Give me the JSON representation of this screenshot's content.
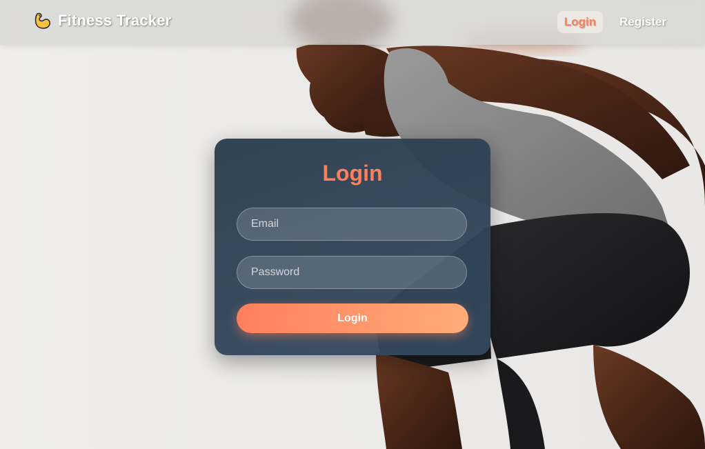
{
  "navbar": {
    "brand_text": "Fitness Tracker",
    "brand_icon": "flexed-biceps-icon",
    "links": [
      {
        "label": "Login",
        "active": true
      },
      {
        "label": "Register",
        "active": false
      }
    ]
  },
  "login_form": {
    "title": "Login",
    "email_placeholder": "Email",
    "email_value": "",
    "password_placeholder": "Password",
    "password_value": "",
    "submit_label": "Login"
  },
  "colors": {
    "accent": "#ff7f5c",
    "accent_gradient_end": "#ffac78",
    "card_bg": "#2c3e50",
    "nav_text": "#ffffff"
  }
}
